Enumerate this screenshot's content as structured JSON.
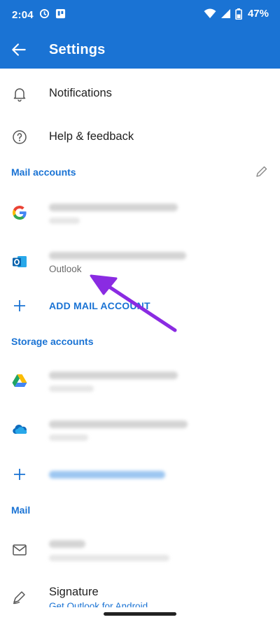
{
  "status": {
    "time": "2:04",
    "battery_pct": "47%"
  },
  "header": {
    "title": "Settings"
  },
  "general": {
    "notifications": "Notifications",
    "help": "Help & feedback"
  },
  "mail_accounts": {
    "title": "Mail accounts",
    "outlook_label": "Outlook",
    "add_label": "ADD MAIL ACCOUNT"
  },
  "storage_accounts": {
    "title": "Storage accounts"
  },
  "mail": {
    "title": "Mail",
    "signature": "Signature",
    "signature_sub": "Get Outlook for Android"
  },
  "colors": {
    "accent": "#1a73d4",
    "annotation_arrow": "#8a2be2"
  }
}
